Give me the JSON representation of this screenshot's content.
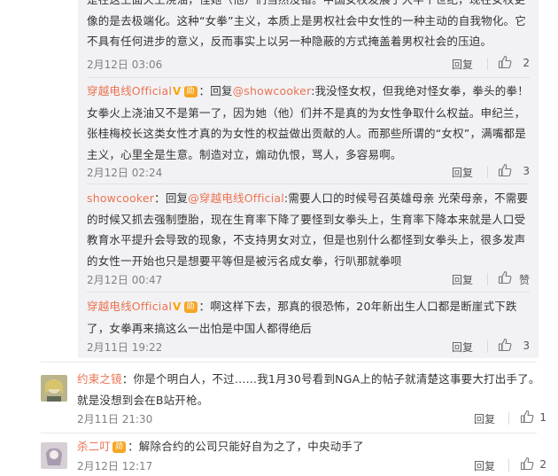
{
  "replies": [
    {
      "text": "是在这上面火上浇油，怪她（他）们当然没错。中国女权发展了大半个世纪，现在女权更像的是去极端化。这种“女拳”主义，本质上是男权社会中女性的一种主动的自我物化。它不具有任何进步的意义，反而事实上以另一种隐蔽的方式掩盖着男权社会的压迫。",
      "time": "2月12日 03:06",
      "reply_label": "回复",
      "likes": "2"
    },
    {
      "user": "穿越电线Official",
      "reply_word": "回复",
      "at_user": "@showcooker",
      "text": ":我没怪女权，但我绝对怪女拳，拳头的拳！女拳火上浇油又不是第一了，因为她（他）们并不是真的为女性争取什么权益。申纪兰，张桂梅校长这类女性才真的为女性的权益做出贡献的人。而那些所谓的“女权”，满嘴都是主义，心里全是生意。制造对立，煽动仇恨，骂人，多容易啊。",
      "time": "2月12日 02:24",
      "reply_label": "回复",
      "likes": "3"
    },
    {
      "user": "showcooker",
      "reply_word": "回复",
      "at_user": "@穿越电线Official",
      "text": ":需要人口的时候号召英雄母亲 光荣母亲，不需要的时候又抓去强制堕胎，现在生育率下降了要怪到女拳头上，生育率下降本来就是人口受教育水平提升会导致的现象，不支持男女对立，但是也别什么都怪到女拳头上，很多发声的女性一开始也只是想要平等但是被污名成女拳，行叭那就拳呗",
      "time": "2月12日 00:47",
      "reply_label": "回复",
      "likes": "赞"
    },
    {
      "user": "穿越电线Official",
      "text": "：啊这样下去，那真的很恐怖，20年新出生人口都是断崖式下跌了，女拳再来搞这么一出怕是中国人都得绝后",
      "time": "2月11日 19:22",
      "reply_label": "回复",
      "likes": "3"
    }
  ],
  "comments": [
    {
      "user": "约束之镜",
      "text": "：你是个明白人，不过……我1月30号看到NGA上的帖子就清楚这事要大打出手了。就是没想到会在B站开枪。",
      "time": "2月11日 21:30",
      "reply_label": "回复",
      "likes": "1"
    },
    {
      "user": "杀二叮",
      "text": "：解除合约的公司只能好自为之了，中央动手了",
      "time": "2月12日 12:17",
      "reply_label": "回复",
      "likes": "2"
    }
  ],
  "badges": {
    "verified": "V",
    "medal": "勋"
  },
  "colors": {
    "accent": "#eb7350",
    "panel": "#f2f2f5",
    "meta": "#808080"
  },
  "icons": {
    "like": "thumbs-up-icon"
  }
}
